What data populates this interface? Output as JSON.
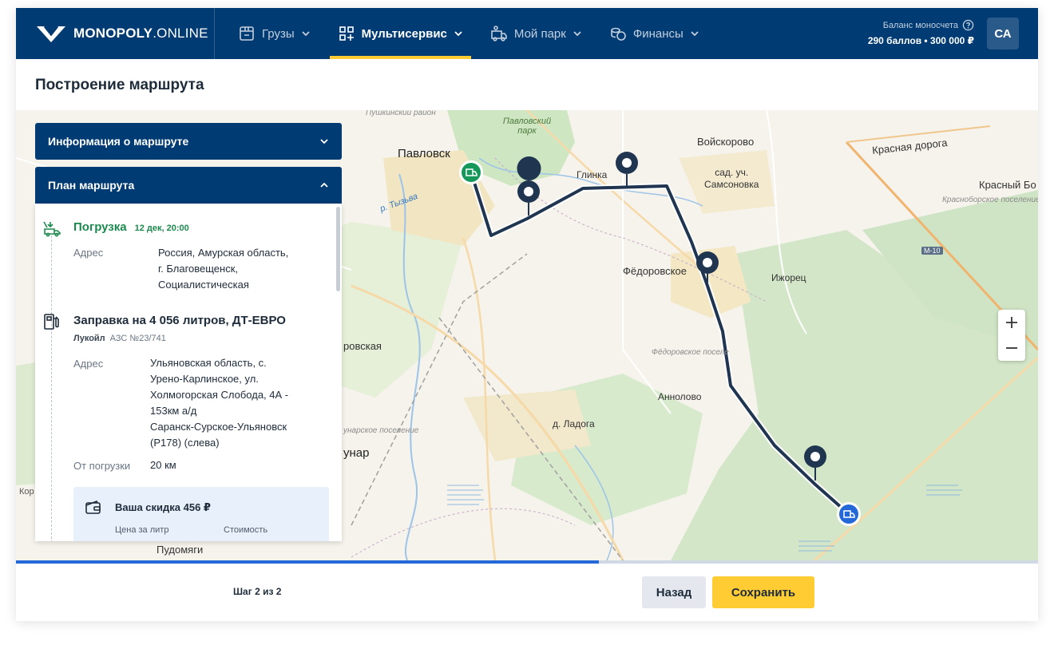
{
  "app": {
    "logo_bold": "MONOPOLY",
    "logo_thin": ".ONLINE"
  },
  "nav": {
    "items": [
      {
        "label": "Грузы",
        "icon": "cargo-box-icon"
      },
      {
        "label": "Мультисервис",
        "icon": "multiservice-grid-icon",
        "active": true
      },
      {
        "label": "Мой парк",
        "icon": "fleet-truck-icon"
      },
      {
        "label": "Финансы",
        "icon": "finance-coins-icon"
      }
    ]
  },
  "balance": {
    "label": "Баланс моносчета",
    "value": "290 баллов • 300 000 ₽"
  },
  "user": {
    "initials": "СА"
  },
  "page": {
    "title": "Построение маршрута"
  },
  "panel": {
    "info_title": "Информация о маршруте",
    "plan_title": "План маршрута",
    "loading": {
      "title": "Погрузка",
      "date": "12 дек, 20:00",
      "address_label": "Адрес",
      "address_lines": [
        "Россия, Амурская область,",
        "г. Благовещенск,",
        "Социалистическая"
      ]
    },
    "fuel": {
      "title": "Заправка на 4 056 литров, ДТ-ЕВРО",
      "brand": "Лукойл",
      "station": "АЗС №23/741",
      "address_label": "Адрес",
      "address_lines": [
        "Ульяновская область, с.",
        "Урено-Карлинское, ул.",
        "Холмогорская Слобода, 4А -",
        "153км а/д",
        "Саранск-Сурское-Ульяновск",
        "(Р178) (слева)"
      ],
      "distance_label": "От погрузки",
      "distance_value": "20 км"
    },
    "discount": {
      "title": "Ваша скидка 456 ₽",
      "col1": "Цена за литр",
      "col2": "Стоимость"
    }
  },
  "map": {
    "labels": {
      "pavlovsk": "Павловск",
      "pavlovsky_park": "Павловский\nпарк",
      "pushkin": "Пушкинский район",
      "tyzva": "р. Тызьва",
      "glinka": "Глинка",
      "voyskorovo": "Войскорово",
      "samsonovka": "сад. уч.\nСамсоновка",
      "krasnaya_doroga": "Красная дорога",
      "krasny_bor": "Красный Бо",
      "krasnoborskoe": "Красноборское поселение",
      "m10": "М-10",
      "fedorovskoe": "Фёдоровское",
      "izhorets": "Ижорец",
      "fedorovskoe_pos": "Фёдоровское поселе",
      "annolovo": "Аннолово",
      "ladoga": "д. Ладога",
      "unar_pos": "унарское поселение",
      "unar": "унар",
      "rovskaya": "ровская",
      "pudomyagi": "Пудомяги",
      "kor": "Кор"
    },
    "route_progress": 0.57
  },
  "footer": {
    "step": "Шаг 2 из 2",
    "back": "Назад",
    "save": "Сохранить"
  },
  "colors": {
    "header": "#003b73",
    "accent": "#ffcc33",
    "route": "#1f3550",
    "start": "#16985a",
    "end": "#2468d8"
  }
}
